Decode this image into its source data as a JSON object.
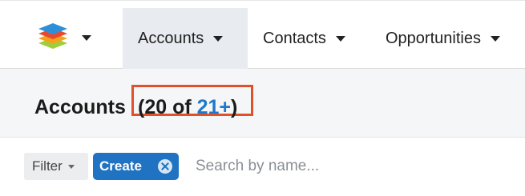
{
  "nav": {
    "logo_icon": "stacked-layers-logo-icon",
    "tabs": [
      {
        "label": "Accounts",
        "active": true
      },
      {
        "label": "Contacts",
        "active": false
      },
      {
        "label": "Opportunities",
        "active": false
      }
    ]
  },
  "header": {
    "title": "Accounts",
    "count_prefix": "(20 of ",
    "count_total": "21+",
    "count_suffix": ")",
    "highlight_color": "#e0502b"
  },
  "filterbar": {
    "filter_label": "Filter",
    "create_label": "Create",
    "search_placeholder": "Search by name..."
  },
  "colors": {
    "accent": "#1f73c2",
    "link": "#1f78c8",
    "active_tab_bg": "#e8ebef"
  }
}
